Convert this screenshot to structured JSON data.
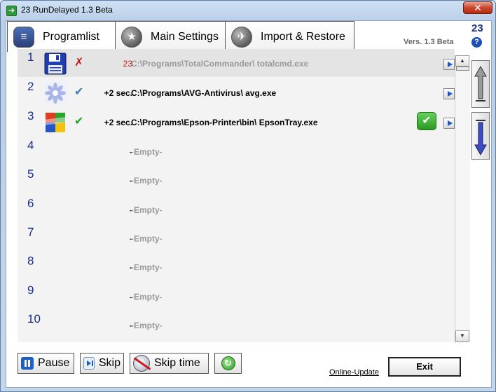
{
  "window": {
    "title": "23  RunDelayed 1.3 Beta",
    "close_glyph": "✕"
  },
  "tabs": [
    {
      "label": "Programlist",
      "active": true,
      "icon": "programlist-icon"
    },
    {
      "label": "Main Settings",
      "active": false,
      "icon": "star-icon"
    },
    {
      "label": "Import & Restore",
      "active": false,
      "icon": "runner-icon"
    }
  ],
  "header": {
    "counter": "23",
    "version": "Vers. 1.3 Beta",
    "help_glyph": "?"
  },
  "rows": [
    {
      "num": "1",
      "icon": "floppy-disk-icon",
      "check": "✗",
      "check_color": "#c01818",
      "delay": "23",
      "delay_color": "#c01818",
      "path": "C:\\Programs\\TotalCommander\\ totalcmd.exe",
      "muted": true,
      "play": true
    },
    {
      "num": "2",
      "icon": "avg-icon",
      "check": "✔",
      "check_color": "#3a7bb8",
      "delay": "+2 sec.",
      "delay_color": "#000000",
      "path": "C:\\Programs\\AVG-Antivirus\\ avg.exe",
      "muted": false,
      "play": true
    },
    {
      "num": "3",
      "icon": "epson-icon",
      "check": "✔",
      "check_color": "#1fa81f",
      "delay": "+2 sec.",
      "delay_color": "#000000",
      "path": "C:\\Programs\\Epson-Printer\\bin\\ EpsonTray.exe",
      "muted": false,
      "play": true,
      "ok_badge": "✔"
    },
    {
      "num": "4",
      "delay": "-",
      "path": "-Empty-",
      "muted": true
    },
    {
      "num": "5",
      "delay": "-",
      "path": "-Empty-",
      "muted": true
    },
    {
      "num": "6",
      "delay": "-",
      "path": "-Empty-",
      "muted": true
    },
    {
      "num": "7",
      "delay": "-",
      "path": "-Empty-",
      "muted": true
    },
    {
      "num": "8",
      "delay": "-",
      "path": "-Empty-",
      "muted": true
    },
    {
      "num": "9",
      "delay": "-",
      "path": "-Empty-",
      "muted": true
    },
    {
      "num": "10",
      "delay": "-",
      "path": "-Empty-",
      "muted": true
    }
  ],
  "scroll": {
    "up_glyph": "▲",
    "down_glyph": "▼"
  },
  "footer": {
    "pause_label": "Pause",
    "skip_label": "Skip",
    "skip_time_label": "Skip time",
    "online_update": "Online-Update",
    "exit_label": "Exit"
  }
}
